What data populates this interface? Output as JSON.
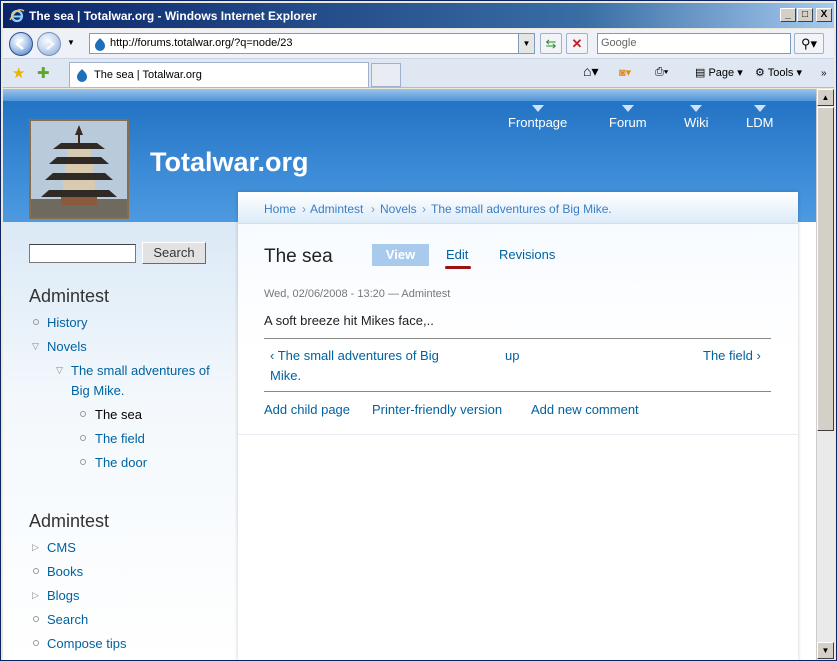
{
  "window": {
    "title": "The sea | Totalwar.org - Windows Internet Explorer",
    "controls": {
      "minimize": "_",
      "maximize": "□",
      "close": "X"
    }
  },
  "address_bar": {
    "url": "http://forums.totalwar.org/?q=node/23",
    "search_placeholder": "Google"
  },
  "tabs": [
    {
      "label": "The sea | Totalwar.org"
    }
  ],
  "command_bar": {
    "page": "Page",
    "tools": "Tools"
  },
  "site": {
    "name": "Totalwar.org",
    "primary_links": [
      "Frontpage",
      "Forum",
      "Wiki",
      "LDM"
    ]
  },
  "sidebar": {
    "search_button": "Search",
    "block1": {
      "title": "Admintest",
      "items": [
        {
          "label": "History"
        },
        {
          "label": "Novels"
        },
        {
          "label": "The small adventures of",
          "label2": "Big Mike."
        },
        {
          "label": "The sea"
        },
        {
          "label": "The field"
        },
        {
          "label": "The door"
        }
      ]
    },
    "block2": {
      "title": "Admintest",
      "items": [
        {
          "label": "CMS"
        },
        {
          "label": "Books"
        },
        {
          "label": "Blogs"
        },
        {
          "label": "Search"
        },
        {
          "label": "Compose tips"
        }
      ]
    }
  },
  "breadcrumb": {
    "items": [
      "Home",
      "Admintest",
      "Novels",
      "The small adventures of Big Mike."
    ],
    "sep": "›"
  },
  "node": {
    "title": "The sea",
    "tabs": {
      "view": "View",
      "edit": "Edit",
      "revisions": "Revisions"
    },
    "submitted": "Wed, 02/06/2008 - 13:20 — Admintest",
    "body": "A soft breeze hit Mikes face,..",
    "book_nav": {
      "prev_line1": "‹ The small adventures of Big",
      "prev_line2": "Mike.",
      "up": "up",
      "next": "The field ›"
    },
    "links": [
      "Add child page",
      "Printer-friendly version",
      "Add new comment"
    ]
  },
  "colors": {
    "link": "#0062a0",
    "header": "#3b8ad6",
    "view_tab": "#a8cbed"
  }
}
